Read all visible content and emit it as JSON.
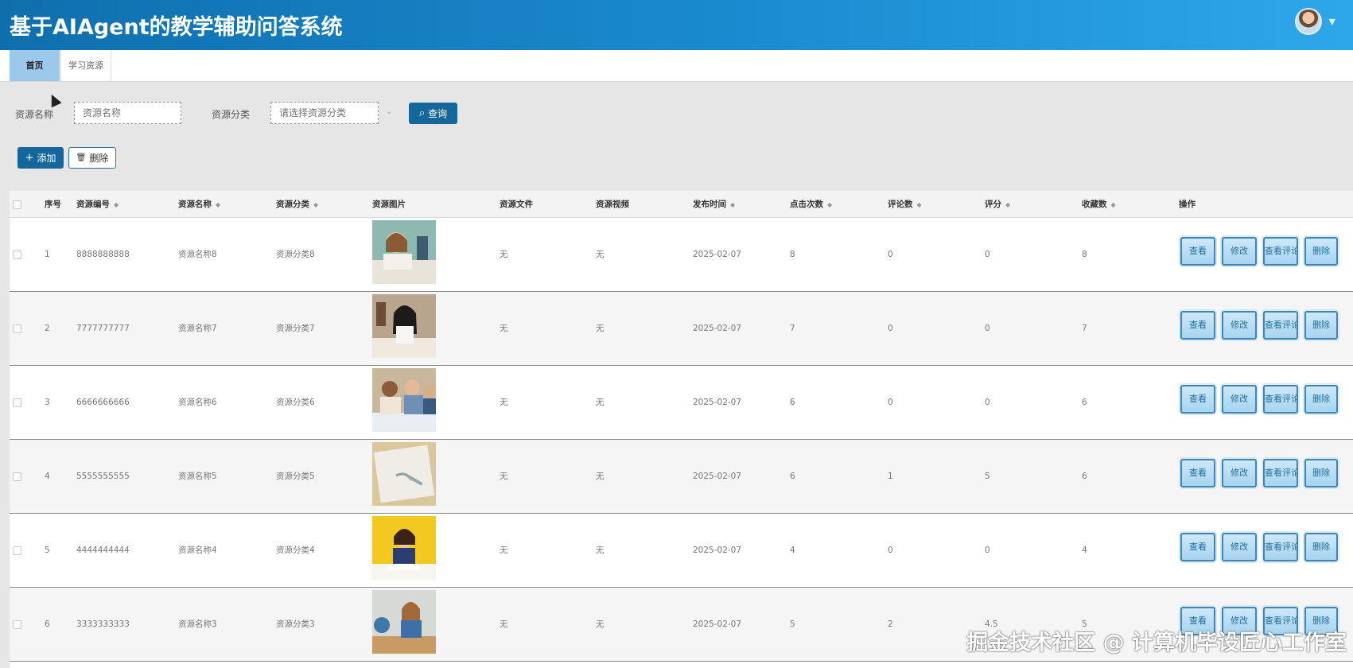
{
  "app": {
    "title": "基于AIAgent的教学辅助问答系统",
    "header_gradient": [
      "#0f6fad",
      "#2ea7ea"
    ]
  },
  "tabs": [
    {
      "label": "首页",
      "active": true
    },
    {
      "label": "学习资源",
      "active": false
    }
  ],
  "search": {
    "name_label": "资源名称",
    "name_placeholder": "资源名称",
    "category_label": "资源分类",
    "category_placeholder": "请选择资源分类",
    "query_button": "查询"
  },
  "toolbar": {
    "add_button": "添加",
    "delete_button": "删除"
  },
  "table": {
    "columns": [
      "序号",
      "资源编号",
      "资源名称",
      "资源分类",
      "资源图片",
      "资源文件",
      "资源视频",
      "发布时间",
      "点击次数",
      "评论数",
      "评分",
      "收藏数",
      "操作"
    ],
    "actions": [
      "查看",
      "修改",
      "查看评论",
      "删除"
    ],
    "rows": [
      {
        "index": "1",
        "code": "8888888888",
        "name": "资源名称8",
        "category": "资源分类8",
        "file": "无",
        "video": "无",
        "date": "2025-02-07",
        "clicks": "8",
        "comments": "0",
        "rating": "0",
        "favorites": "8",
        "image": "girl-reading-book"
      },
      {
        "index": "2",
        "code": "7777777777",
        "name": "资源名称7",
        "category": "资源分类7",
        "file": "无",
        "video": "无",
        "date": "2025-02-07",
        "clicks": "7",
        "comments": "0",
        "rating": "0",
        "favorites": "7",
        "image": "student-studying"
      },
      {
        "index": "3",
        "code": "6666666666",
        "name": "资源名称6",
        "category": "资源分类6",
        "file": "无",
        "video": "无",
        "date": "2025-02-07",
        "clicks": "6",
        "comments": "0",
        "rating": "0",
        "favorites": "6",
        "image": "group-of-students"
      },
      {
        "index": "4",
        "code": "5555555555",
        "name": "资源名称5",
        "category": "资源分类5",
        "file": "无",
        "video": "无",
        "date": "2025-02-07",
        "clicks": "6",
        "comments": "1",
        "rating": "5",
        "favorites": "6",
        "image": "open-notebook"
      },
      {
        "index": "5",
        "code": "4444444444",
        "name": "资源名称4",
        "category": "资源分类4",
        "file": "无",
        "video": "无",
        "date": "2025-02-07",
        "clicks": "4",
        "comments": "0",
        "rating": "0",
        "favorites": "4",
        "image": "girl-writing-yellow"
      },
      {
        "index": "6",
        "code": "3333333333",
        "name": "资源名称3",
        "category": "资源分类3",
        "file": "无",
        "video": "无",
        "date": "2025-02-07",
        "clicks": "5",
        "comments": "2",
        "rating": "4.5",
        "favorites": "5",
        "image": "girl-at-desk-globe"
      }
    ]
  },
  "watermark": "掘金技术社区 @ 计算机毕设匠心工作室"
}
